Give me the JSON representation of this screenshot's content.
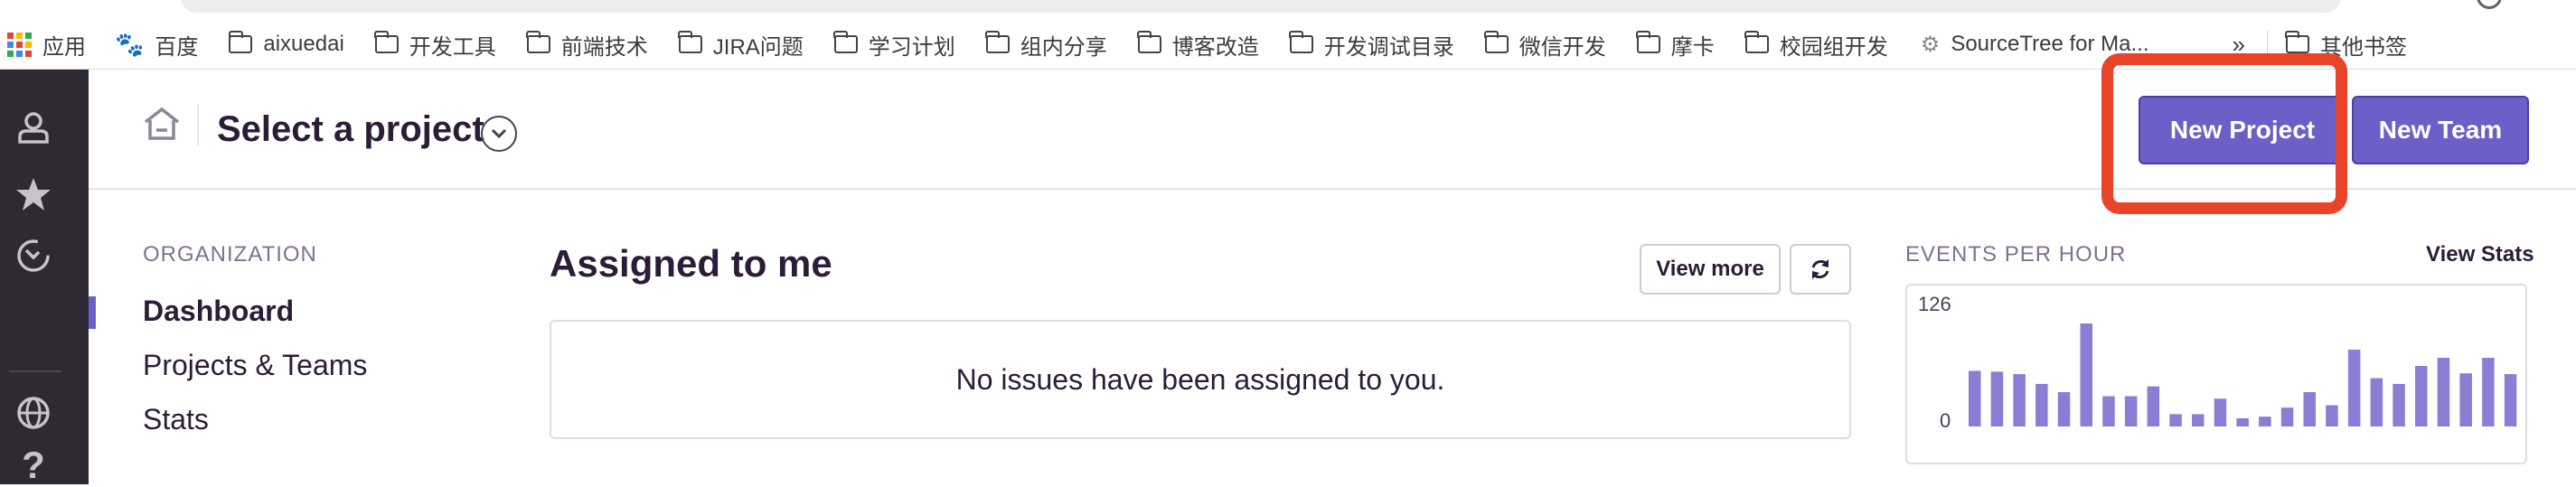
{
  "bookmarks": {
    "apps_label": "应用",
    "items": [
      {
        "label": "百度",
        "icon": "baidu-paw-icon"
      },
      {
        "label": "aixuedai",
        "icon": "folder-icon"
      },
      {
        "label": "开发工具",
        "icon": "folder-icon"
      },
      {
        "label": "前端技术",
        "icon": "folder-icon"
      },
      {
        "label": "JIRA问题",
        "icon": "folder-icon"
      },
      {
        "label": "学习计划",
        "icon": "folder-icon"
      },
      {
        "label": "组内分享",
        "icon": "folder-icon"
      },
      {
        "label": "博客改造",
        "icon": "folder-icon"
      },
      {
        "label": "开发调试目录",
        "icon": "folder-icon"
      },
      {
        "label": "微信开发",
        "icon": "folder-icon"
      },
      {
        "label": "摩卡",
        "icon": "folder-icon"
      },
      {
        "label": "校园组开发",
        "icon": "folder-icon"
      },
      {
        "label": "SourceTree for Ma...",
        "icon": "sourcetree-icon"
      }
    ],
    "overflow": "»",
    "other_label": "其他书签"
  },
  "sidebar": {
    "icons": [
      "user-icon",
      "star-icon",
      "activity-clock-icon",
      "globe-icon",
      "help-icon"
    ],
    "help_glyph": "?"
  },
  "header": {
    "title": "Select a project",
    "new_project": "New Project",
    "new_team": "New Team"
  },
  "nav": {
    "heading": "ORGANIZATION",
    "items": [
      "Dashboard",
      "Projects & Teams",
      "Stats"
    ],
    "active": "Dashboard"
  },
  "assigned": {
    "title": "Assigned to me",
    "view_more": "View more",
    "empty_message": "No issues have been assigned to you."
  },
  "events": {
    "heading": "EVENTS PER HOUR",
    "view_stats": "View Stats"
  },
  "colors": {
    "accent": "#6c5fc7",
    "bar": "#8a7dd3",
    "sidebar_bg": "#2f2936",
    "highlight": "#e8442a"
  },
  "chart_data": {
    "type": "bar",
    "title": "",
    "y_ticks": [
      0,
      126
    ],
    "ylim": [
      0,
      126
    ],
    "values": [
      68,
      67,
      64,
      52,
      42,
      126,
      37,
      37,
      49,
      15,
      15,
      34,
      10,
      12,
      23,
      42,
      26,
      94,
      59,
      52,
      74,
      84,
      65,
      84,
      64
    ]
  }
}
